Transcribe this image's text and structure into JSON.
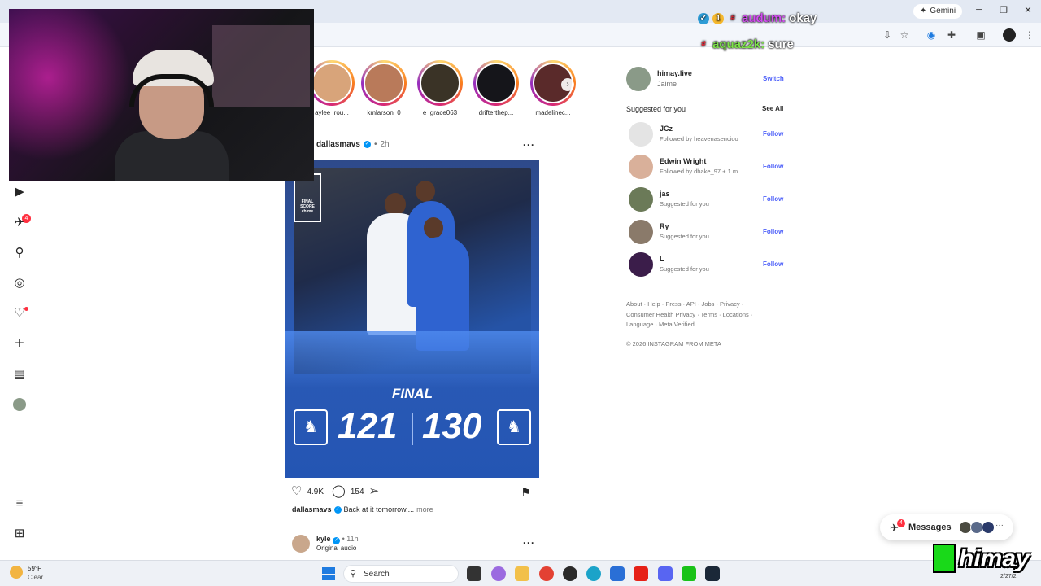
{
  "browser": {
    "gemini_label": "Gemini",
    "minimize": "─",
    "restore": "❐",
    "close": "✕"
  },
  "chat": [
    {
      "user": "audum:",
      "message": "okay"
    },
    {
      "user": "aquaz2k:",
      "message": "sure"
    }
  ],
  "nav": {
    "messages_badge": "4"
  },
  "stories": [
    {
      "name": "aylee_rou..."
    },
    {
      "name": "kmlarson_0"
    },
    {
      "name": "e_grace063"
    },
    {
      "name": "drifterthep..."
    },
    {
      "name": "madelinec..."
    }
  ],
  "post": {
    "username": "dallasmavs",
    "time": "2h",
    "image_final_label": "FINAL",
    "score_left": "121",
    "score_right": "130",
    "score_box_text": "FINAL SCORE chime",
    "likes": "4.9K",
    "comments": "154",
    "caption_user": "dallasmavs",
    "caption_text": "Back at it tomorrow....",
    "caption_more": "more"
  },
  "post2": {
    "username": "kyle",
    "time": "11h",
    "audio": "Original audio"
  },
  "account": {
    "username": "himay.live",
    "name": "Jaime",
    "switch_label": "Switch"
  },
  "suggestions": {
    "title": "Suggested for you",
    "see_all": "See All",
    "follow_label": "Follow",
    "items": [
      {
        "name": "JCz",
        "sub": "Followed by heavenasencioo",
        "avatar_color": "#e4e4e4"
      },
      {
        "name": "Edwin Wright",
        "sub": "Followed by dbake_97 + 1 m",
        "avatar_color": "#d9b09a"
      },
      {
        "name": "jas",
        "sub": "Suggested for you",
        "avatar_color": "#6b7a58"
      },
      {
        "name": "Ry",
        "sub": "Suggested for you",
        "avatar_color": "#8a7a6a"
      },
      {
        "name": "L",
        "sub": "Suggested for you",
        "avatar_color": "#3b1d4a"
      }
    ]
  },
  "footer": {
    "links": "About · Help · Press · API · Jobs · Privacy · Consumer Health Privacy · Terms · Locations · Language · Meta Verified",
    "copyright": "© 2026 INSTAGRAM FROM META"
  },
  "messages_pill": {
    "label": "Messages",
    "badge": "4"
  },
  "stream_logo": "himay",
  "taskbar": {
    "temp": "59°F",
    "condition": "Clear",
    "search_label": "Search",
    "clock": "2/27/2"
  },
  "colors": {
    "accent_link": "#4a5df9",
    "badge_red": "#ff3040",
    "verified_blue": "#0095f6"
  }
}
